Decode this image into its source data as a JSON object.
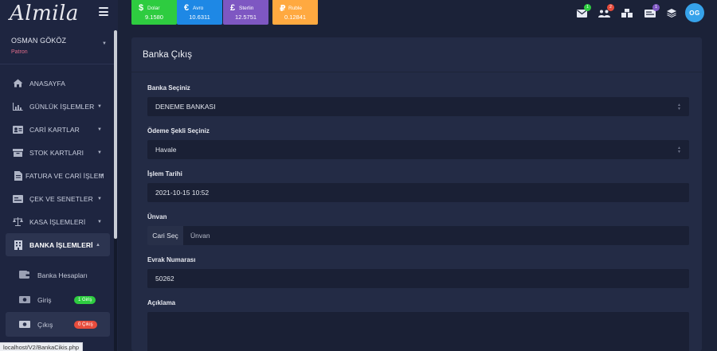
{
  "brand": {
    "logo": "Almila"
  },
  "user": {
    "name": "OSMAN GÖKÖZ",
    "role": "Patron",
    "initials": "OG"
  },
  "currencies": [
    {
      "symbol": "$",
      "name": "Dolar",
      "value": "9.1580",
      "color": "#2ecc40"
    },
    {
      "symbol": "€",
      "name": "Avro",
      "value": "10.6311",
      "color": "#1e88e5"
    },
    {
      "symbol": "£",
      "name": "Sterlin",
      "value": "12.5751",
      "color": "#7e57c2"
    },
    {
      "symbol": "₽",
      "name": "Ruble",
      "value": "0.12841",
      "color": "#ffa940"
    }
  ],
  "topbar_icons": [
    {
      "icon": "envelope-icon",
      "badge": "1",
      "badge_color": "#2ecc40"
    },
    {
      "icon": "users-icon",
      "badge": "2",
      "badge_color": "#e74c3c"
    },
    {
      "icon": "cubes-icon",
      "badge": "",
      "badge_color": "#ffa940"
    },
    {
      "icon": "message-icon",
      "badge": "1",
      "badge_color": "#7e57c2"
    },
    {
      "icon": "layers-icon",
      "badge": "",
      "badge_color": ""
    }
  ],
  "sidebar": {
    "items": [
      {
        "label": "ANASAYFA",
        "icon": "home-icon"
      },
      {
        "label": "GÜNLÜK İŞLEMLER",
        "icon": "chart-icon"
      },
      {
        "label": "CARİ KARTLAR",
        "icon": "id-card-icon"
      },
      {
        "label": "STOK KARTLARI",
        "icon": "box-icon"
      },
      {
        "label": "FATURA VE CARİ İŞLEM",
        "icon": "file-icon"
      },
      {
        "label": "ÇEK VE SENETLER",
        "icon": "money-check-icon"
      },
      {
        "label": "KASA İŞLEMLERİ",
        "icon": "balance-icon"
      },
      {
        "label": "BANKA İŞLEMLERİ",
        "icon": "building-icon"
      }
    ],
    "subitems": [
      {
        "label": "Banka Hesapları",
        "icon": "wallet-icon",
        "badge": ""
      },
      {
        "label": "Giriş",
        "icon": "money-bill-icon",
        "badge": "1 Giriş",
        "badge_color": "#2ecc40"
      },
      {
        "label": "Çıkış",
        "icon": "money-bill-icon",
        "badge": "0 Çıkış",
        "badge_color": "#e74c3c"
      }
    ]
  },
  "status_url": "localhost/V2/BankaCikis.php",
  "form": {
    "title": "Banka Çıkış",
    "bank_label": "Banka Seçiniz",
    "bank_value": "DENEME BANKASI",
    "payment_label": "Ödeme Şekli Seçiniz",
    "payment_value": "Havale",
    "date_label": "İşlem Tarihi",
    "date_value": "2021-10-15 10:52",
    "title_label": "Ünvan",
    "select_account_button": "Cari Seç",
    "title_placeholder": "Ünvan",
    "doc_label": "Evrak Numarası",
    "doc_value": "50262",
    "desc_label": "Açıklama"
  }
}
